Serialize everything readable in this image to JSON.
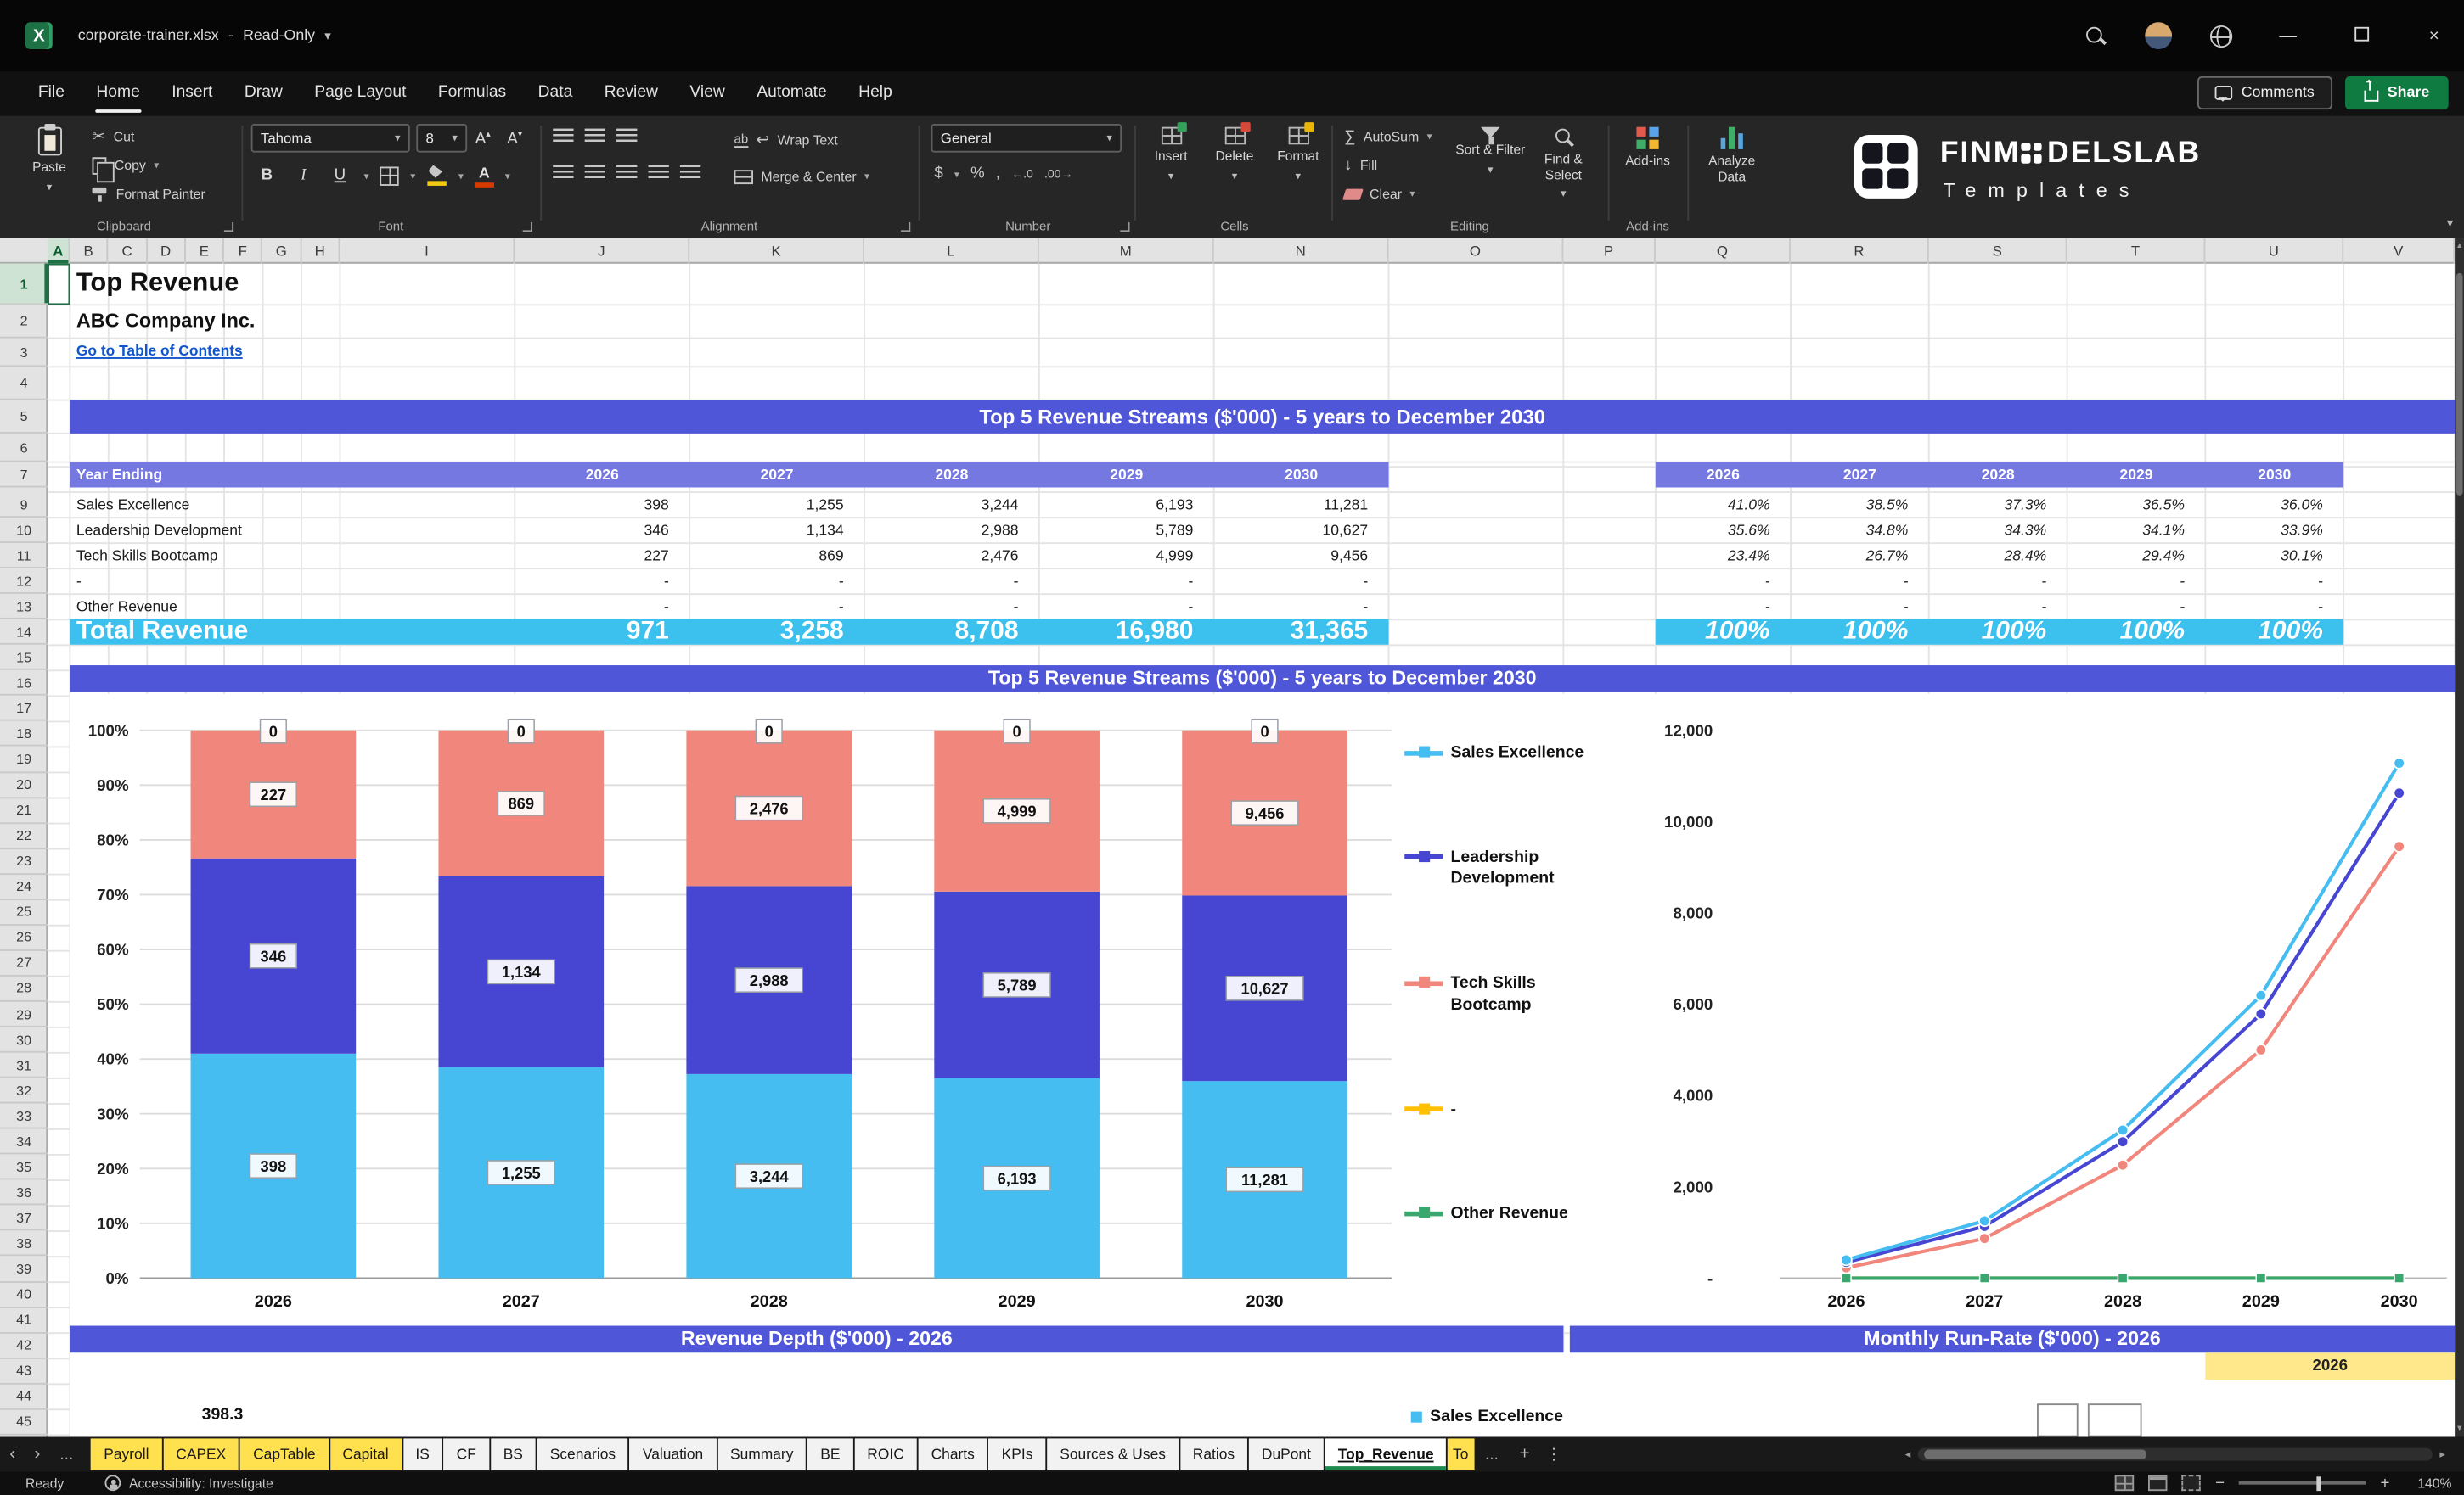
{
  "colors": {
    "banner": "#5056D8",
    "table_header_band": "#7478E0",
    "total_row": "#3CC0ED",
    "highlight_cell": "#FFE88C",
    "tab_yellow": "#FFE150",
    "excel_green": "#1E7145",
    "share_green": "#0F7B41"
  },
  "glyphs": {
    "dropdown": "▾",
    "close": "×",
    "minimize": "—",
    "nav_left": "‹",
    "nav_right": "›",
    "more": "…",
    "plus": "+",
    "minus": "−",
    "cut": "✂",
    "sum": "∑",
    "fill_arrow": "↓",
    "dollar": "$",
    "percent": "%",
    "comma": ",",
    "wrap_return": "↩",
    "tri_left": "◂",
    "tri_right": "▸",
    "tri_up": "▴",
    "tri_down": "▾",
    "bold": "B",
    "italic": "I",
    "underline": "U",
    "dec_left": "←.0",
    "dec_right": ".00→"
  },
  "titlebar": {
    "title": "corporate-trainer.xlsx",
    "separator": "-",
    "mode": "Read-Only"
  },
  "menubar": {
    "tabs": [
      {
        "label": "File",
        "active": "false"
      },
      {
        "label": "Home",
        "active": "true"
      },
      {
        "label": "Insert",
        "active": "false"
      },
      {
        "label": "Draw",
        "active": "false"
      },
      {
        "label": "Page Layout",
        "active": "false"
      },
      {
        "label": "Formulas",
        "active": "false"
      },
      {
        "label": "Data",
        "active": "false"
      },
      {
        "label": "Review",
        "active": "false"
      },
      {
        "label": "View",
        "active": "false"
      },
      {
        "label": "Automate",
        "active": "false"
      },
      {
        "label": "Help",
        "active": "false"
      }
    ],
    "comments": "Comments",
    "share": "Share"
  },
  "ribbon": {
    "paste": "Paste",
    "cut": "Cut",
    "copy": "Copy",
    "format_painter": "Format Painter",
    "font_name": "Tahoma",
    "font_size": "8",
    "wrap_text": "Wrap Text",
    "merge_center": "Merge & Center",
    "number_format": "General",
    "insert": "Insert",
    "delete": "Delete",
    "format": "Format",
    "autosum": "AutoSum",
    "fill": "Fill",
    "clear": "Clear",
    "sort_filter": "Sort & Filter",
    "find_select": "Find & Select",
    "addins": "Add-ins",
    "analyze_data": "Analyze Data",
    "groups": [
      "Clipboard",
      "Font",
      "Alignment",
      "Number",
      "Cells",
      "Editing",
      "Add-ins"
    ],
    "brand_prefix": "FINM",
    "brand_suffix": "DELSLAB",
    "brand_sub": "Templates"
  },
  "grid": {
    "columns": [
      "A",
      "B",
      "C",
      "D",
      "E",
      "F",
      "G",
      "H",
      "I",
      "J",
      "K",
      "L",
      "M",
      "N",
      "O",
      "P",
      "Q",
      "R",
      "S",
      "T",
      "U",
      "V"
    ],
    "rows": [
      "1",
      "2",
      "3",
      "4",
      "5",
      "6",
      "7",
      "9",
      "10",
      "11",
      "12",
      "13",
      "14",
      "15",
      "16",
      "17",
      "18",
      "19",
      "20",
      "21",
      "22",
      "23",
      "24",
      "25",
      "26",
      "27",
      "28",
      "29",
      "30",
      "31",
      "32",
      "33",
      "34",
      "35",
      "36",
      "37",
      "38",
      "39",
      "40",
      "41",
      "42",
      "43",
      "44",
      "45"
    ]
  },
  "sheet": {
    "title": "Top Revenue",
    "company": "ABC Company Inc.",
    "toc_link": "Go to Table of Contents",
    "banner1": "Top 5 Revenue Streams ($'000) - 5 years to December 2030",
    "year_cell": "2026",
    "table": {
      "header": "Year Ending",
      "years": [
        "2026",
        "2027",
        "2028",
        "2029",
        "2030"
      ],
      "rows": [
        {
          "label": "Sales Excellence",
          "values": [
            "398",
            "1,255",
            "3,244",
            "6,193",
            "11,281"
          ],
          "pcts": [
            "41.0%",
            "38.5%",
            "37.3%",
            "36.5%",
            "36.0%"
          ]
        },
        {
          "label": "Leadership Development",
          "values": [
            "346",
            "1,134",
            "2,988",
            "5,789",
            "10,627"
          ],
          "pcts": [
            "35.6%",
            "34.8%",
            "34.3%",
            "34.1%",
            "33.9%"
          ]
        },
        {
          "label": "Tech Skills Bootcamp",
          "values": [
            "227",
            "869",
            "2,476",
            "4,999",
            "9,456"
          ],
          "pcts": [
            "23.4%",
            "26.7%",
            "28.4%",
            "29.4%",
            "30.1%"
          ]
        },
        {
          "label": "-",
          "values": [
            "-",
            "-",
            "-",
            "-",
            "-"
          ],
          "pcts": [
            "-",
            "-",
            "-",
            "-",
            "-"
          ]
        },
        {
          "label": "Other Revenue",
          "values": [
            "-",
            "-",
            "-",
            "-",
            "-"
          ],
          "pcts": [
            "-",
            "-",
            "-",
            "-",
            "-"
          ]
        }
      ],
      "total": {
        "label": "Total Revenue",
        "values": [
          "971",
          "3,258",
          "8,708",
          "16,980",
          "31,365"
        ],
        "pcts": [
          "100%",
          "100%",
          "100%",
          "100%",
          "100%"
        ]
      }
    }
  },
  "chart_data": [
    {
      "type": "bar",
      "subtype": "stacked-100pct",
      "title": "Top 5 Revenue Streams ($'000) - 5 years to December 2030",
      "categories": [
        "2026",
        "2027",
        "2028",
        "2029",
        "2030"
      ],
      "series": [
        {
          "name": "Sales Excellence",
          "color": "#45BDF0",
          "values": [
            398,
            1255,
            3244,
            6193,
            11281
          ]
        },
        {
          "name": "Leadership Development",
          "color": "#4746D2",
          "values": [
            346,
            1134,
            2988,
            5789,
            10627
          ]
        },
        {
          "name": "Tech Skills Bootcamp",
          "color": "#F0867C",
          "values": [
            227,
            869,
            2476,
            4999,
            9456
          ]
        },
        {
          "name": "-",
          "color": "#FFC000",
          "values": [
            0,
            0,
            0,
            0,
            0
          ]
        },
        {
          "name": "Other Revenue",
          "color": "#3AA76F",
          "values": [
            0,
            0,
            0,
            0,
            0
          ]
        }
      ],
      "y_ticks": [
        "100%",
        "90%",
        "80%",
        "70%",
        "60%",
        "50%",
        "40%",
        "30%",
        "20%",
        "10%",
        "0%"
      ],
      "data_labels": true,
      "legend_position": "right",
      "grid": true
    },
    {
      "type": "line",
      "categories": [
        "2026",
        "2027",
        "2028",
        "2029",
        "2030"
      ],
      "series": [
        {
          "name": "Sales Excellence",
          "color": "#45BDF0",
          "values": [
            398,
            1255,
            3244,
            6193,
            11281
          ]
        },
        {
          "name": "Leadership Development",
          "color": "#4746D2",
          "values": [
            346,
            1134,
            2988,
            5789,
            10627
          ]
        },
        {
          "name": "Tech Skills Bootcamp",
          "color": "#F0867C",
          "values": [
            227,
            869,
            2476,
            4999,
            9456
          ]
        },
        {
          "name": "-",
          "color": "#FFC000",
          "values": [
            0,
            0,
            0,
            0,
            0
          ]
        },
        {
          "name": "Other Revenue",
          "color": "#3AA76F",
          "values": [
            0,
            0,
            0,
            0,
            0
          ]
        }
      ],
      "ylim": [
        0,
        12000
      ],
      "y_ticks": [
        "12,000",
        "10,000",
        "8,000",
        "6,000",
        "4,000",
        "2,000",
        "-"
      ],
      "grid": false
    },
    {
      "type": "bar",
      "title": "Revenue Depth ($'000) - 2026",
      "series": [
        {
          "name": "Sales Excellence",
          "color": "#45BDF0"
        }
      ],
      "visible_values": [
        "398.3"
      ]
    },
    {
      "type": "bar",
      "title": "Monthly Run-Rate ($'000) - 2026",
      "year": "2026"
    }
  ],
  "sheet_tabs": {
    "tabs": [
      {
        "label": "Payroll",
        "kind": "yellow"
      },
      {
        "label": "CAPEX",
        "kind": "yellow"
      },
      {
        "label": "CapTable",
        "kind": "yellow"
      },
      {
        "label": "Capital",
        "kind": "yellow"
      },
      {
        "label": "IS",
        "kind": "plain"
      },
      {
        "label": "CF",
        "kind": "plain"
      },
      {
        "label": "BS",
        "kind": "plain"
      },
      {
        "label": "Scenarios",
        "kind": "plain"
      },
      {
        "label": "Valuation",
        "kind": "plain"
      },
      {
        "label": "Summary",
        "kind": "plain"
      },
      {
        "label": "BE",
        "kind": "plain"
      },
      {
        "label": "ROIC",
        "kind": "plain"
      },
      {
        "label": "Charts",
        "kind": "plain"
      },
      {
        "label": "KPIs",
        "kind": "plain"
      },
      {
        "label": "Sources & Uses",
        "kind": "plain"
      },
      {
        "label": "Ratios",
        "kind": "plain"
      },
      {
        "label": "DuPont",
        "kind": "plain"
      },
      {
        "label": "Top_Revenue",
        "kind": "active"
      },
      {
        "label": "To",
        "kind": "yellow-partial"
      }
    ]
  },
  "statusbar": {
    "ready": "Ready",
    "accessibility": "Accessibility: Investigate",
    "zoom": "140%"
  }
}
